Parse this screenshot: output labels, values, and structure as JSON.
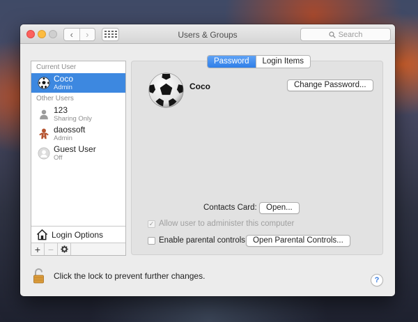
{
  "window": {
    "title": "Users & Groups"
  },
  "toolbar": {
    "back_icon": "chevron-left",
    "forward_icon": "chevron-right",
    "grid_icon": "show-all-grid",
    "search_placeholder": "Search"
  },
  "sidebar": {
    "current_user_label": "Current User",
    "current_user": {
      "name": "Coco",
      "role": "Admin",
      "icon": "soccer-ball"
    },
    "other_users_label": "Other Users",
    "other_users": [
      {
        "name": "123",
        "role": "Sharing Only",
        "icon": "person-silhouette"
      },
      {
        "name": "daossoft",
        "role": "Admin",
        "icon": "gingerbread"
      },
      {
        "name": "Guest User",
        "role": "Off",
        "icon": "guest-silhouette"
      }
    ],
    "login_options_label": "Login Options",
    "buttons": {
      "add": "+",
      "remove": "−",
      "settings_icon": "gear"
    }
  },
  "tabs": [
    {
      "label": "Password",
      "active": true
    },
    {
      "label": "Login Items",
      "active": false
    }
  ],
  "detail": {
    "user_name": "Coco",
    "change_password_label": "Change Password...",
    "contacts_card_label": "Contacts Card:",
    "open_label": "Open...",
    "allow_admin_label": "Allow user to administer this computer",
    "allow_admin_checked": true,
    "parental_controls_label": "Enable parental controls",
    "parental_controls_checked": false,
    "open_parental_controls_label": "Open Parental Controls..."
  },
  "footer": {
    "lock_text": "Click the lock to prevent further changes.",
    "help_label": "?"
  },
  "colors": {
    "selection": "#3d88e0",
    "tab_active": "#2f7fe8",
    "close": "#fc615d",
    "minimize": "#fdbc40"
  }
}
